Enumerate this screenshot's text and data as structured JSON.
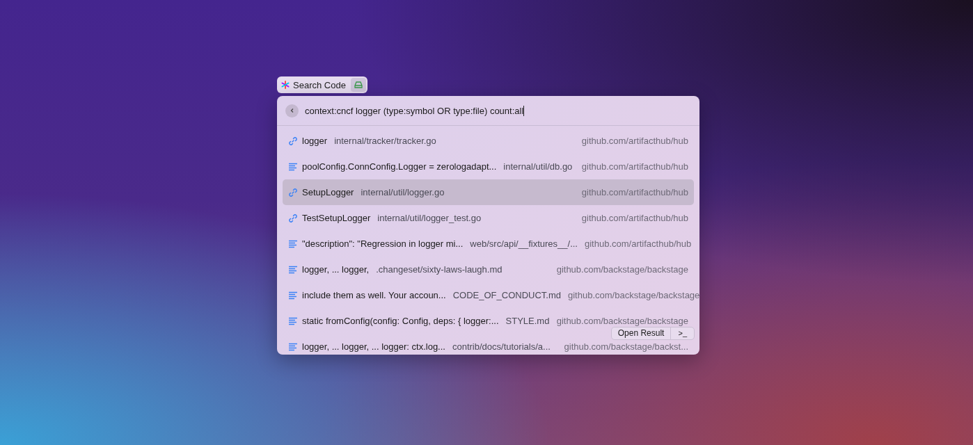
{
  "chip": {
    "label": "Search Code"
  },
  "search": {
    "value": "context:cncf logger (type:symbol OR type:file) count:all"
  },
  "results": [
    {
      "kind": "symbol",
      "title": "logger",
      "path": "internal/tracker/tracker.go",
      "repo": "github.com/artifacthub/hub",
      "selected": false
    },
    {
      "kind": "content",
      "title": "poolConfig.ConnConfig.Logger = zerologadapt...",
      "path": "internal/util/db.go",
      "repo": "github.com/artifacthub/hub",
      "selected": false
    },
    {
      "kind": "symbol",
      "title": "SetupLogger",
      "path": "internal/util/logger.go",
      "repo": "github.com/artifacthub/hub",
      "selected": true
    },
    {
      "kind": "symbol",
      "title": "TestSetupLogger",
      "path": "internal/util/logger_test.go",
      "repo": "github.com/artifacthub/hub",
      "selected": false
    },
    {
      "kind": "content",
      "title": "\"description\": \"Regression in logger mi...",
      "path": "web/src/api/__fixtures__/...",
      "repo": "github.com/artifacthub/hub",
      "selected": false
    },
    {
      "kind": "content",
      "title": "logger, ... logger,",
      "path": ".changeset/sixty-laws-laugh.md",
      "repo": "github.com/backstage/backstage",
      "selected": false
    },
    {
      "kind": "content",
      "title": "include them as well. Your accoun...",
      "path": "CODE_OF_CONDUCT.md",
      "repo": "github.com/backstage/backstage",
      "selected": false
    },
    {
      "kind": "content",
      "title": "static fromConfig(config: Config, deps: { logger:...",
      "path": "STYLE.md",
      "repo": "github.com/backstage/backstage",
      "selected": false
    },
    {
      "kind": "content",
      "title": "logger, ... logger, ... logger: ctx.log...",
      "path": "contrib/docs/tutorials/a...",
      "repo": "github.com/backstage/backst...",
      "selected": false
    }
  ],
  "actions": {
    "primary": "Open Result",
    "secondary": ">_"
  }
}
